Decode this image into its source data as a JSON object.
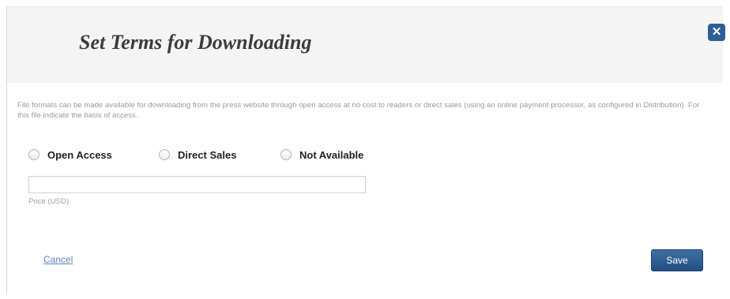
{
  "dialog": {
    "title": "Set Terms for Downloading",
    "close_icon": "close-icon"
  },
  "description": "File formats can be made available for downloading from the press website through open access at no cost to readers or direct sales (using an online payment processor, as configured in Distribution). For this file indicate the basis of access.",
  "access_options": [
    {
      "label": "Open Access",
      "selected": false
    },
    {
      "label": "Direct Sales",
      "selected": false
    },
    {
      "label": "Not Available",
      "selected": false
    }
  ],
  "price": {
    "value": "",
    "label": "Price (USD)"
  },
  "actions": {
    "cancel_label": "Cancel",
    "save_label": "Save"
  },
  "colors": {
    "accent": "#2d5f97",
    "link": "#5b87b8",
    "header_bg": "#f4f4f4"
  }
}
